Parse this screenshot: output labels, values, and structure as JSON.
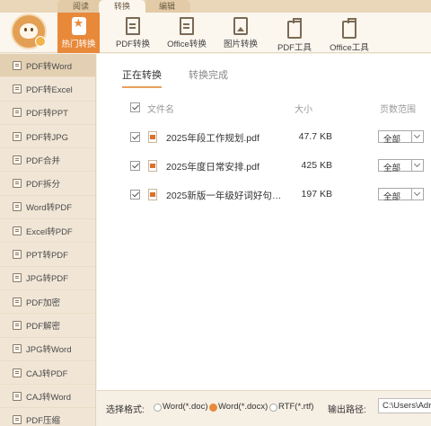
{
  "top_tabs": [
    {
      "label": "阅读"
    },
    {
      "label": "转换"
    },
    {
      "label": "编辑"
    }
  ],
  "ribbon": {
    "tools": [
      {
        "label": "热门转换",
        "icon": "star-icon"
      },
      {
        "label": "PDF转换",
        "icon": "pdf-file-icon"
      },
      {
        "label": "Office转换",
        "icon": "office-doc-icon"
      },
      {
        "label": "图片转换",
        "icon": "image-icon"
      },
      {
        "label": "PDF工具",
        "icon": "toolbox-icon"
      },
      {
        "label": "Office工具",
        "icon": "toolbox-icon"
      }
    ]
  },
  "sidebar": {
    "items": [
      {
        "label": "PDF转Word"
      },
      {
        "label": "PDF转Excel"
      },
      {
        "label": "PDF转PPT"
      },
      {
        "label": "PDF转JPG"
      },
      {
        "label": "PDF合并"
      },
      {
        "label": "PDF拆分"
      },
      {
        "label": "Word转PDF"
      },
      {
        "label": "Excel转PDF"
      },
      {
        "label": "PPT转PDF"
      },
      {
        "label": "JPG转PDF"
      },
      {
        "label": "PDF加密"
      },
      {
        "label": "PDF解密"
      },
      {
        "label": "JPG转Word"
      },
      {
        "label": "CAJ转PDF"
      },
      {
        "label": "CAJ转Word"
      },
      {
        "label": "PDF压缩"
      }
    ]
  },
  "main": {
    "tabs": [
      {
        "label": "正在转换"
      },
      {
        "label": "转换完成"
      }
    ],
    "columns": {
      "name": "文件名",
      "size": "大小",
      "pages": "页数范围"
    },
    "files": [
      {
        "name": "2025年段工作规划.pdf",
        "size": "47.7 KB",
        "pages": "全部"
      },
      {
        "name": "2025年度日常安排.pdf",
        "size": "425 KB",
        "pages": "全部"
      },
      {
        "name": "2025新版一年级好词好句…",
        "size": "197 KB",
        "pages": "全部"
      }
    ]
  },
  "bottom": {
    "format_label": "选择格式:",
    "formats": [
      {
        "label": "Word(*.doc)"
      },
      {
        "label": "Word(*.docx)"
      },
      {
        "label": "RTF(*.rtf)"
      }
    ],
    "selected_format": "Word(*.docx)",
    "output_label": "输出路径:",
    "output_path": "C:\\Users\\Adr"
  },
  "colors": {
    "accent": "#e8893a",
    "sidebar_bg": "#f1e6d6",
    "ribbon_bg": "#fbf6ee"
  }
}
